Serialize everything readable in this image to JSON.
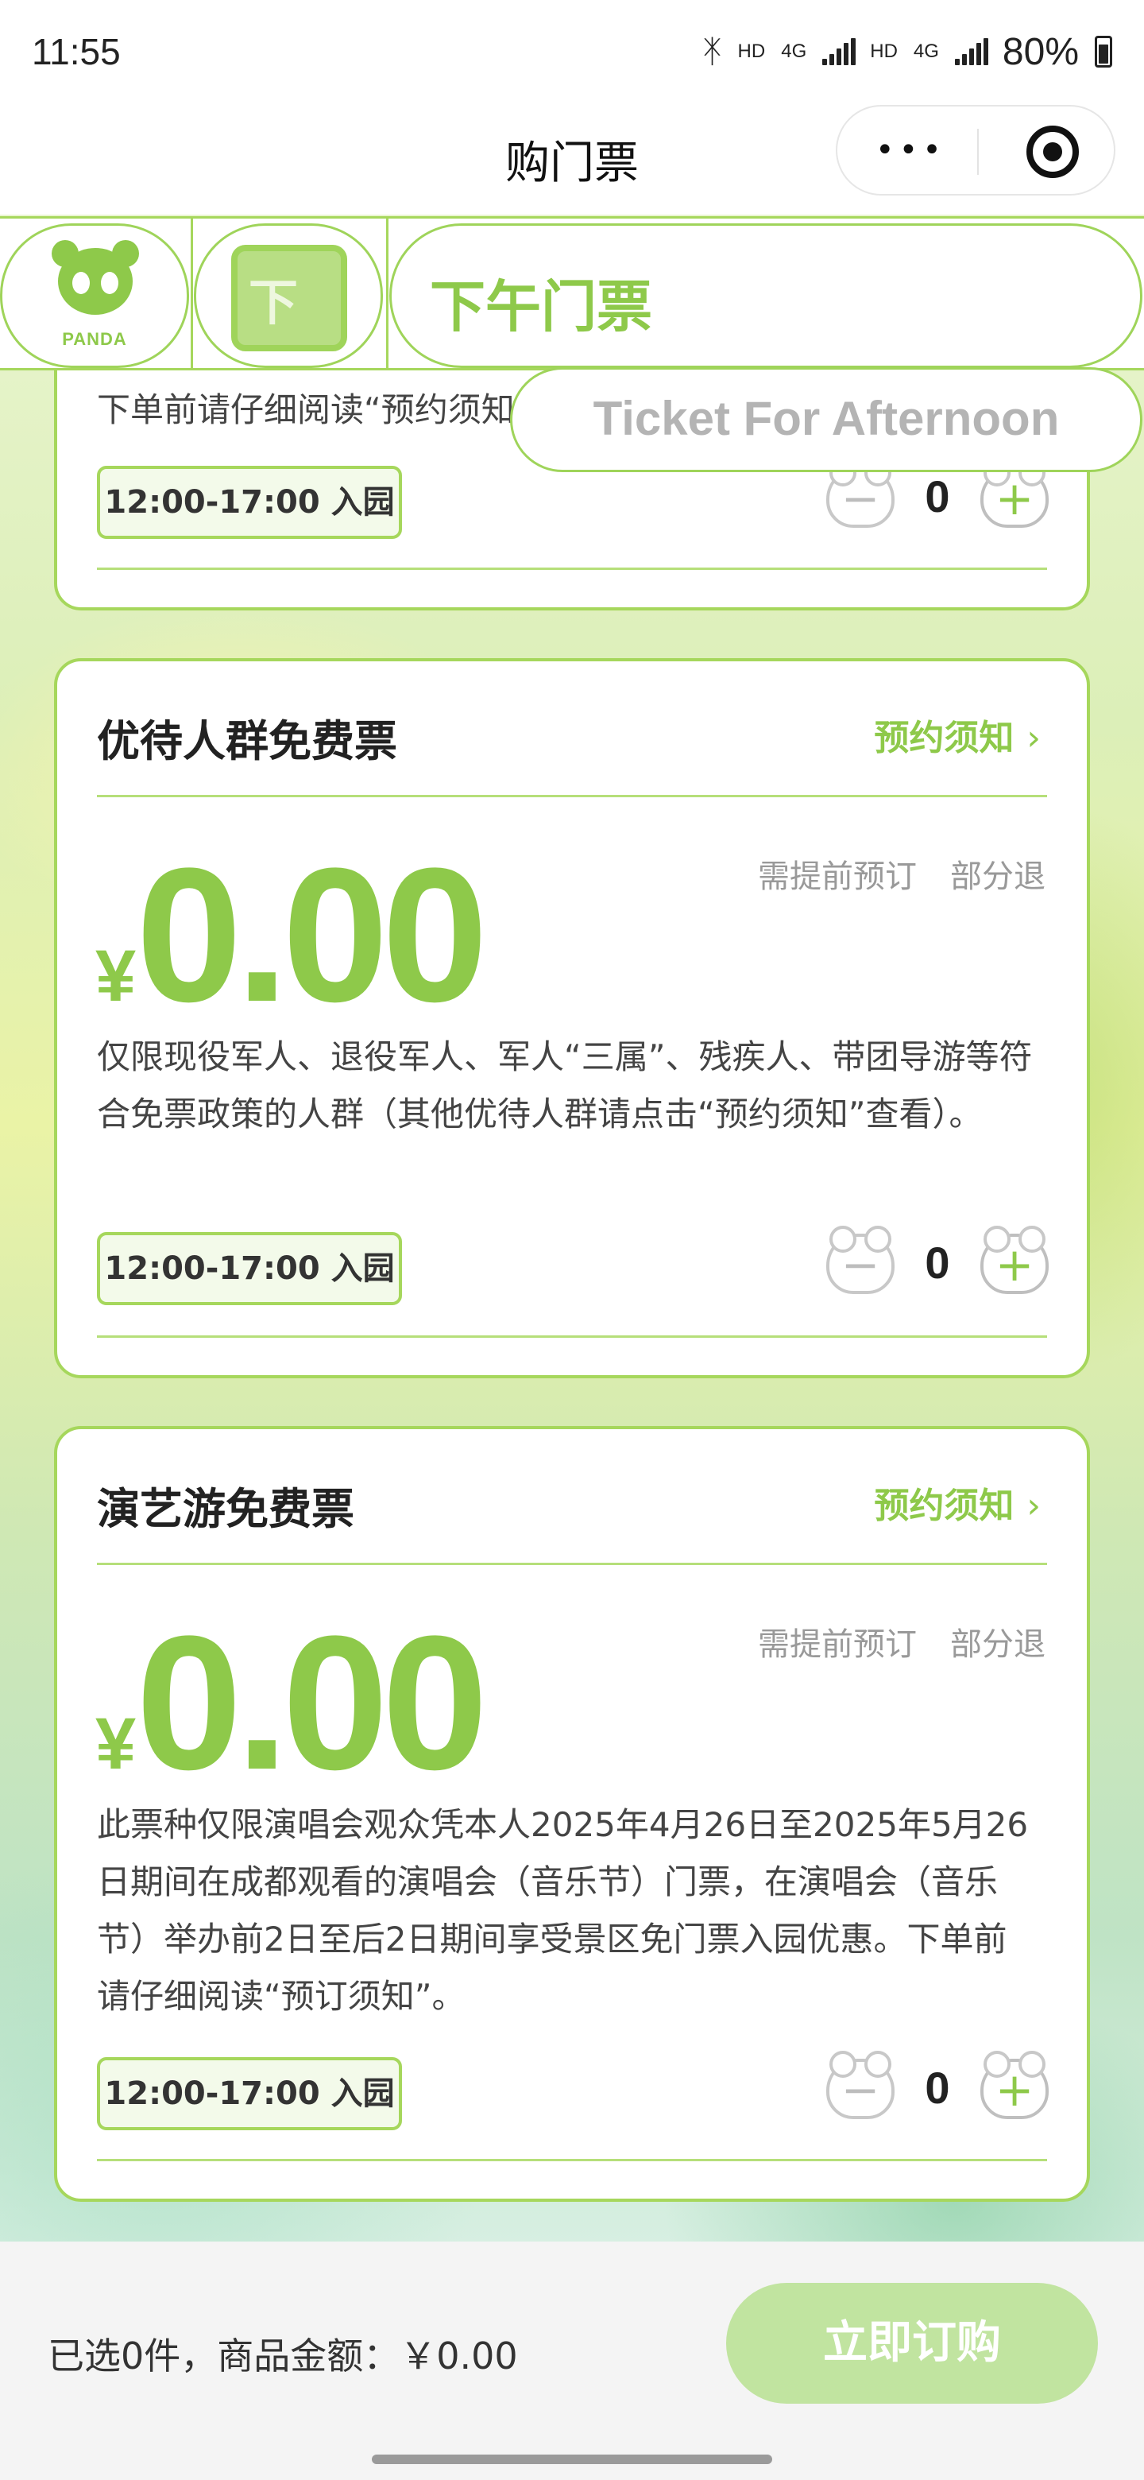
{
  "status": {
    "time": "11:55",
    "hd1": "HD",
    "net1": "4G",
    "hd2": "HD",
    "net2": "4G",
    "battery": "80%"
  },
  "nav": {
    "title": "购门票"
  },
  "tabs": {
    "logo_text": "PANDA",
    "ticket_icon_char": "下",
    "active_label": "下午门票",
    "active_sub": "Ticket For Afternoon"
  },
  "cards": [
    {
      "desc_partial": "下单前请仔细阅读“预约须知”。",
      "time": "12:00-17:00 入园",
      "qty": "0"
    },
    {
      "name": "优待人群免费票",
      "notice": "预约须知",
      "currency": "¥",
      "price": "0.00",
      "tag1": "需提前预订",
      "tag2": "部分退",
      "desc": "仅限现役军人、退役军人、军人“三属”、残疾人、带团导游等符合免票政策的人群（其他优待人群请点击“预约须知”查看）。",
      "time": "12:00-17:00 入园",
      "qty": "0"
    },
    {
      "name": "演艺游免费票",
      "notice": "预约须知",
      "currency": "¥",
      "price": "0.00",
      "tag1": "需提前预订",
      "tag2": "部分退",
      "desc": "此票种仅限演唱会观众凭本人2025年4月26日至2025年5月26日期间在成都观看的演唱会（音乐节）门票，在演唱会（音乐节）举办前2日至后2日期间享受景区免门票入园优惠。下单前请仔细阅读“预订须知”。",
      "time": "12:00-17:00 入园",
      "qty": "0"
    }
  ],
  "stepper": {
    "minus": "−",
    "plus": "+"
  },
  "footer": {
    "summary": "已选0件，商品金额：￥0.00",
    "buy_label": "立即订购"
  },
  "colors": {
    "accent": "#8ec94a",
    "border": "#a6d75c",
    "buy_disabled": "#c1e4a0"
  },
  "icons": [
    "bluetooth-icon",
    "signal-icon",
    "battery-icon",
    "more-icon",
    "target-icon",
    "panda-logo-icon",
    "ticket-icon",
    "chevron-right-icon",
    "minus-icon",
    "plus-icon"
  ]
}
